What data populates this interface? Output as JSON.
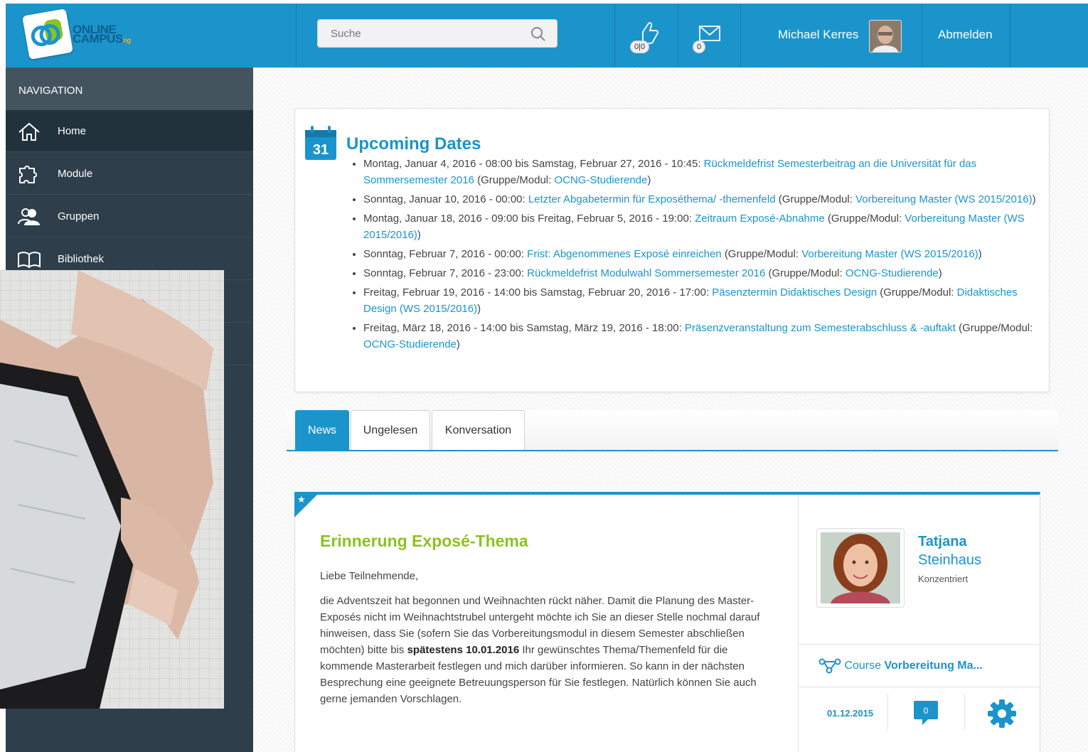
{
  "header": {
    "logo_line1": "ONLINE",
    "logo_line2": "CAMPUS",
    "logo_suffix": "ng",
    "search_placeholder": "Suche",
    "likes_badge": "0|0",
    "messages_badge": "0",
    "user_name": "Michael Kerres",
    "logout_label": "Abmelden"
  },
  "sidebar": {
    "heading": "NAVIGATION",
    "items": [
      {
        "label": "Home",
        "icon": "home-icon"
      },
      {
        "label": "Module",
        "icon": "puzzle-icon"
      },
      {
        "label": "Gruppen",
        "icon": "group-icon"
      },
      {
        "label": "Bibliothek",
        "icon": "book-icon"
      }
    ]
  },
  "upcoming": {
    "icon_day": "31",
    "title": "Upcoming Dates",
    "gm_prefix": "(Gruppe/Modul: ",
    "gm_suffix": ")",
    "items": [
      {
        "date": "Montag, Januar 4, 2016 - 08:00 bis Samstag, Februar 27, 2016 - 10:45: ",
        "event": "Rückmeldefrist Semesterbeitrag an die Universität für das Sommersemester 2016",
        "group": "OCNG-Studierende"
      },
      {
        "date": "Sonntag, Januar 10, 2016 - 00:00: ",
        "event": "Letzter Abgabetermin für Exposéthema/ -themenfeld",
        "group": "Vorbereitung Master (WS 2015/2016)"
      },
      {
        "date": "Montag, Januar 18, 2016 - 09:00 bis Freitag, Februar 5, 2016 - 19:00: ",
        "event": "Zeitraum Exposé-Abnahme",
        "group": "Vorbereitung Master (WS 2015/2016)"
      },
      {
        "date": "Sonntag, Februar 7, 2016 - 00:00: ",
        "event": "Frist: Abgenommenes Exposé einreichen",
        "group": "Vorbereitung Master (WS 2015/2016)"
      },
      {
        "date": "Sonntag, Februar 7, 2016 - 23:00: ",
        "event": "Rückmeldefrist Modulwahl Sommersemester 2016",
        "group": "OCNG-Studierende"
      },
      {
        "date": "Freitag, Februar 19, 2016 - 14:00 bis Samstag, Februar 20, 2016 - 17:00: ",
        "event": "Päsenztermin Didaktisches Design",
        "group": "Didaktisches Design (WS 2015/2016)"
      },
      {
        "date": "Freitag, März 18, 2016 - 14:00 bis Samstag, März 19, 2016 - 18:00: ",
        "event": "Präsenzveranstaltung zum Semesterabschluss & -auftakt",
        "group": "OCNG-Studierende"
      }
    ]
  },
  "tabs": [
    {
      "label": "News",
      "active": true
    },
    {
      "label": "Ungelesen",
      "active": false
    },
    {
      "label": "Konversation",
      "active": false
    }
  ],
  "post": {
    "title": "Erinnerung Exposé-Thema",
    "greeting": "Liebe Teilnehmende,",
    "body_before": "die Adventszeit hat begonnen und Weihnachten rückt näher. Damit die Planung des Master-Exposés nicht im Weihnachtstrubel untergeht möchte ich Sie an dieser Stelle nochmal darauf hinweisen, dass Sie (sofern Sie das Vorbereitungsmodul in diesem Semester abschließen möchten) bitte bis ",
    "body_bold": "spätestens 10.01.2016",
    "body_after": " Ihr gewünschtes Thema/Themenfeld für die kommende Masterarbeit festlegen und mich darüber informieren. So kann in der nächsten Besprechung eine geeignete Betreuungsperson für Sie festlegen. Natürlich können Sie auch gerne jemanden Vorschlagen.",
    "author_first": "Tatjana",
    "author_last": "Steinhaus",
    "author_status": "Konzentriert",
    "course_prefix": "Course ",
    "course_name": "Vorbereitung Ma...",
    "date": "01.12.2015",
    "comments": "0"
  },
  "colors": {
    "accent": "#1b94cc",
    "title_green": "#8dc21f",
    "sidebar": "#2e3f4b"
  }
}
